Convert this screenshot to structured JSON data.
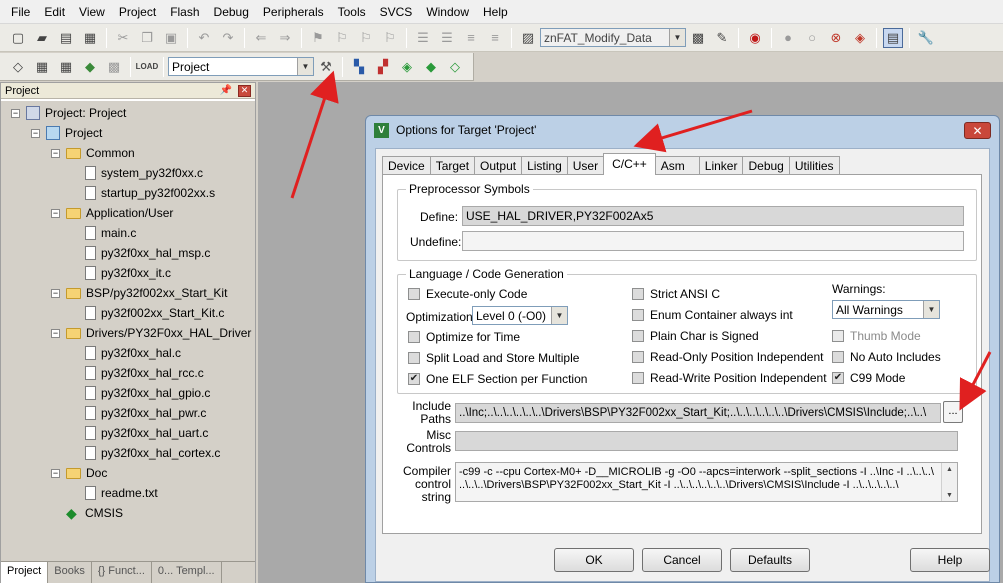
{
  "menu": [
    "File",
    "Edit",
    "View",
    "Project",
    "Flash",
    "Debug",
    "Peripherals",
    "Tools",
    "SVCS",
    "Window",
    "Help"
  ],
  "toolbar": {
    "find_combo_value": "znFAT_Modify_Data",
    "target_combo_value": "Project"
  },
  "project_panel": {
    "title": "Project",
    "tree": [
      {
        "label": "Project: Project",
        "level": 0,
        "kind": "root",
        "expanded": true
      },
      {
        "label": "Project",
        "level": 1,
        "kind": "target",
        "expanded": true
      },
      {
        "label": "Common",
        "level": 2,
        "kind": "folder",
        "expanded": true
      },
      {
        "label": "system_py32f0xx.c",
        "level": 3,
        "kind": "file"
      },
      {
        "label": "startup_py32f002xx.s",
        "level": 3,
        "kind": "file"
      },
      {
        "label": "Application/User",
        "level": 2,
        "kind": "folder",
        "expanded": true
      },
      {
        "label": "main.c",
        "level": 3,
        "kind": "file"
      },
      {
        "label": "py32f0xx_hal_msp.c",
        "level": 3,
        "kind": "file"
      },
      {
        "label": "py32f0xx_it.c",
        "level": 3,
        "kind": "file"
      },
      {
        "label": "BSP/py32f002xx_Start_Kit",
        "level": 2,
        "kind": "folder",
        "expanded": true
      },
      {
        "label": "py32f002xx_Start_Kit.c",
        "level": 3,
        "kind": "file"
      },
      {
        "label": "Drivers/PY32F0xx_HAL_Driver",
        "level": 2,
        "kind": "folder",
        "expanded": true
      },
      {
        "label": "py32f0xx_hal.c",
        "level": 3,
        "kind": "file"
      },
      {
        "label": "py32f0xx_hal_rcc.c",
        "level": 3,
        "kind": "file"
      },
      {
        "label": "py32f0xx_hal_gpio.c",
        "level": 3,
        "kind": "file"
      },
      {
        "label": "py32f0xx_hal_pwr.c",
        "level": 3,
        "kind": "file"
      },
      {
        "label": "py32f0xx_hal_uart.c",
        "level": 3,
        "kind": "file"
      },
      {
        "label": "py32f0xx_hal_cortex.c",
        "level": 3,
        "kind": "file"
      },
      {
        "label": "Doc",
        "level": 2,
        "kind": "folder",
        "expanded": true
      },
      {
        "label": "readme.txt",
        "level": 3,
        "kind": "file"
      },
      {
        "label": "CMSIS",
        "level": 2,
        "kind": "gem"
      }
    ],
    "bottom_tabs": [
      "Project",
      "Books",
      "{} Funct...",
      "0... Templ..."
    ]
  },
  "dialog": {
    "title": "Options for Target 'Project'",
    "tabs": [
      "Device",
      "Target",
      "Output",
      "Listing",
      "User",
      "C/C++",
      "Asm",
      "Linker",
      "Debug",
      "Utilities"
    ],
    "active_tab": "C/C++",
    "preprocessor": {
      "legend": "Preprocessor Symbols",
      "define_label": "Define:",
      "define_value": "USE_HAL_DRIVER,PY32F002Ax5",
      "undefine_label": "Undefine:",
      "undefine_value": ""
    },
    "language": {
      "legend": "Language / Code Generation",
      "execute_only": {
        "label": "Execute-only Code",
        "checked": false
      },
      "optimization_label": "Optimization:",
      "optimization_value": "Level 0 (-O0)",
      "optimize_time": {
        "label": "Optimize for Time",
        "checked": false
      },
      "split_load": {
        "label": "Split Load and Store Multiple",
        "checked": false
      },
      "one_elf": {
        "label": "One ELF Section per Function",
        "checked": true,
        "mark": "✔"
      },
      "strict_ansi": {
        "label": "Strict ANSI C",
        "checked": false
      },
      "enum_container": {
        "label": "Enum Container always int",
        "checked": false
      },
      "plain_char": {
        "label": "Plain Char is Signed",
        "checked": false
      },
      "ro_pi": {
        "label": "Read-Only Position Independent",
        "checked": false
      },
      "rw_pi": {
        "label": "Read-Write Position Independent",
        "checked": false
      },
      "warnings_label": "Warnings:",
      "warnings_value": "All Warnings",
      "thumb_mode": {
        "label": "Thumb Mode",
        "checked": false,
        "disabled": true
      },
      "no_auto_includes": {
        "label": "No Auto Includes",
        "checked": false
      },
      "c99_mode": {
        "label": "C99 Mode",
        "checked": true,
        "mark": "✔"
      }
    },
    "include_paths": {
      "label_line1": "Include",
      "label_line2": "Paths",
      "value": "..\\Inc;..\\..\\..\\..\\..\\..\\Drivers\\BSP\\PY32F002xx_Start_Kit;..\\..\\..\\..\\..\\..\\Drivers\\CMSIS\\Include;..\\..\\",
      "browse_label": "..."
    },
    "misc_controls": {
      "label_line1": "Misc",
      "label_line2": "Controls",
      "value": ""
    },
    "compiler_control": {
      "label_line1": "Compiler",
      "label_line2": "control",
      "label_line3": "string",
      "line1": "-c99 -c --cpu Cortex-M0+ -D__MICROLIB -g -O0 --apcs=interwork --split_sections -I ..\\Inc -I ..\\..\\..\\",
      "line2": "..\\..\\..\\Drivers\\BSP\\PY32F002xx_Start_Kit -I ..\\..\\..\\..\\..\\..\\Drivers\\CMSIS\\Include -I ..\\..\\..\\..\\..\\"
    },
    "buttons": {
      "ok": "OK",
      "cancel": "Cancel",
      "defaults": "Defaults",
      "help": "Help"
    }
  },
  "colors": {
    "annotation_arrow": "#e02020",
    "dialog_frame": "#bcd0e6",
    "workspace": "#a9a9a9"
  }
}
